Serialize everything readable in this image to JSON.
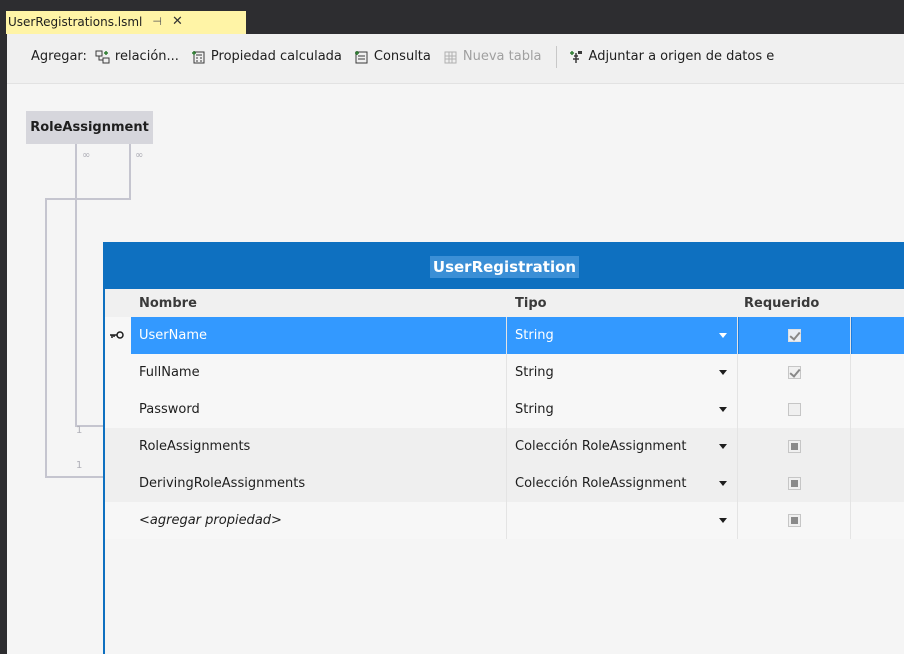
{
  "tab": {
    "title": "UserRegistrations.lsml",
    "pin_icon": "pin-icon",
    "close_icon": "close-icon",
    "pin_glyph": "⊣",
    "close_glyph": "✕",
    "accent": "#fff4a6"
  },
  "toolbar": {
    "add_label": "Agregar:",
    "buttons": [
      {
        "label": "relación...",
        "icon": "relationship-icon",
        "enabled": true
      },
      {
        "label": "Propiedad calculada",
        "icon": "computed-property-icon",
        "enabled": true
      },
      {
        "label": "Consulta",
        "icon": "query-icon",
        "enabled": true
      },
      {
        "label": "Nueva tabla",
        "icon": "new-table-icon",
        "enabled": false
      },
      {
        "label": "Adjuntar a origen de datos e",
        "icon": "attach-datasource-icon",
        "enabled": true
      }
    ]
  },
  "related_entity": {
    "name": "RoleAssignment"
  },
  "relationships": {
    "many_1": "∞",
    "many_2": "∞",
    "one_1": "1",
    "one_2": "1"
  },
  "entity": {
    "name": "UserRegistration",
    "header_color": "#0e70c0",
    "columns": {
      "name": "Nombre",
      "type": "Tipo",
      "required": "Requerido"
    },
    "properties": [
      {
        "name": "UserName",
        "type": "String",
        "required": "checked",
        "key": true,
        "selected": true
      },
      {
        "name": "FullName",
        "type": "String",
        "required": "checked"
      },
      {
        "name": "Password",
        "type": "String",
        "required": "unchecked"
      },
      {
        "name": "RoleAssignments",
        "type": "Colección RoleAssignment",
        "required": "filled"
      },
      {
        "name": "DerivingRoleAssignments",
        "type": "Colección RoleAssignment",
        "required": "filled"
      }
    ],
    "add_property": "<agregar propiedad>"
  }
}
